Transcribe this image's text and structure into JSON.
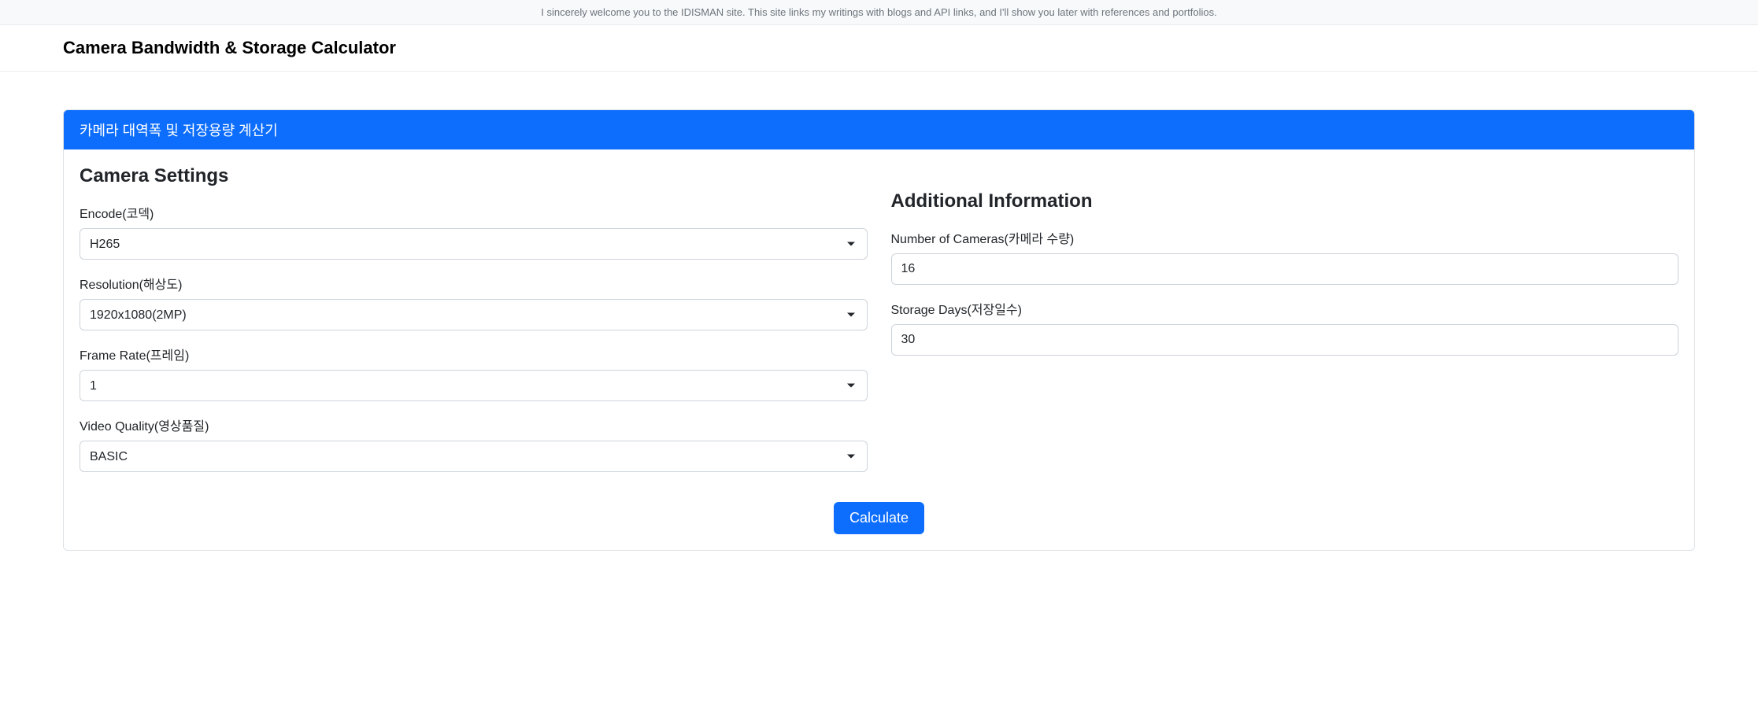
{
  "banner": {
    "text": "I sincerely welcome you to the IDISMAN site. This site links my writings with blogs and API links, and I'll show you later with references and portfolios."
  },
  "navbar": {
    "title": "Camera Bandwidth & Storage Calculator"
  },
  "card": {
    "header": "카메라 대역폭 및 저장용량 계산기"
  },
  "cameraSettings": {
    "title": "Camera Settings",
    "encode": {
      "label": "Encode(코덱)",
      "value": "H265"
    },
    "resolution": {
      "label": "Resolution(해상도)",
      "value": "1920x1080(2MP)"
    },
    "frameRate": {
      "label": "Frame Rate(프레임)",
      "value": "1"
    },
    "videoQuality": {
      "label": "Video Quality(영상품질)",
      "value": "BASIC"
    }
  },
  "additionalInfo": {
    "title": "Additional Information",
    "numberOfCameras": {
      "label": "Number of Cameras(카메라 수량)",
      "value": "16"
    },
    "storageDays": {
      "label": "Storage Days(저장일수)",
      "value": "30"
    }
  },
  "actions": {
    "calculate": "Calculate"
  }
}
